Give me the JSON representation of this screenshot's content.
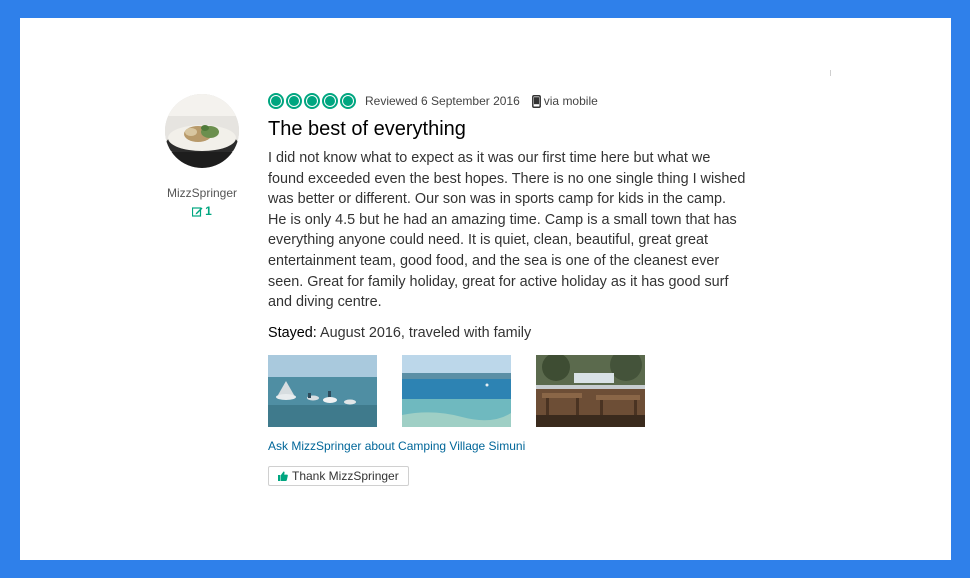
{
  "reviewer": {
    "username": "MizzSpringer",
    "contributions": "1",
    "avatar_icon": "food-photo-avatar"
  },
  "review": {
    "rating": 5,
    "rating_max": 5,
    "reviewed_date": "Reviewed 6 September 2016",
    "via": "via mobile",
    "title": "The best of everything",
    "body": "I did not know what to expect as it was our first time here but what we found exceeded even the best hopes. There is no one single thing I wished was better or different. Our son was in sports camp for kids in the camp. He is only 4.5 but he had an amazing time. Camp is a small town that has everything anyone could need. It is quiet, clean, beautiful, great great entertainment team, good food, and the sea is one of the cleanest ever seen. Great for family holiday, great for active holiday as it has good surf and diving centre.",
    "stayed_label": "Stayed:",
    "stayed_value": " August 2016, traveled with family"
  },
  "photos": [
    {
      "icon": "water-park-photo"
    },
    {
      "icon": "clear-sea-photo"
    },
    {
      "icon": "terrace-restaurant-photo"
    }
  ],
  "ask_link": "Ask MizzSpringer about Camping Village Simuni",
  "thank_button": "Thank MizzSpringer",
  "colors": {
    "background": "#2f80ea",
    "accent_green": "#00a680",
    "link_blue": "#006699"
  }
}
